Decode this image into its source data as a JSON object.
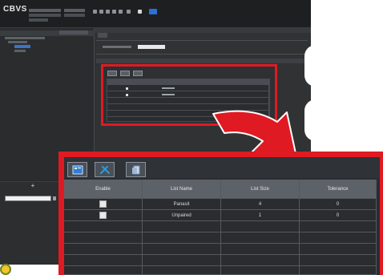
{
  "app": {
    "logo": "CBVS",
    "table_headers": [
      "Enable",
      "List Name",
      "List Size",
      "Tolerance"
    ],
    "rows": [
      {
        "enabled": true,
        "name": "Panasit",
        "size": "4",
        "tolerance": "0"
      },
      {
        "enabled": true,
        "name": "Unpaired",
        "size": "1",
        "tolerance": "0"
      }
    ],
    "new_button": "+"
  },
  "colors": {
    "highlight": "#e01a22",
    "selection": "#3b74c4",
    "toolbar_accent": "#2d6fd6"
  },
  "icons": [
    "list-icon",
    "tools-icon",
    "document-icon"
  ]
}
